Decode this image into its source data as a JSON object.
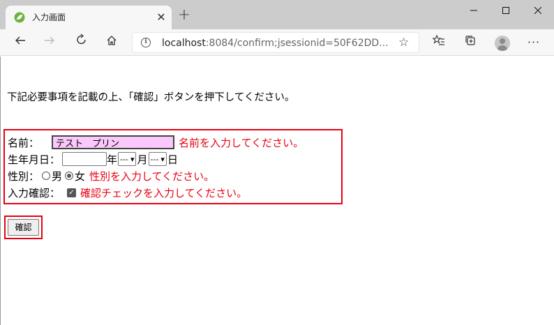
{
  "browser": {
    "tab_title": "入力画面",
    "new_tab_glyph": "+",
    "close_glyph": "✕",
    "url_host": "localhost",
    "url_rest": ":8084/confirm;jsessionid=50F62DD..."
  },
  "page": {
    "instruction": "下記必要事項を記載の上、「確認」ボタンを押下してください。",
    "form": {
      "name_label": "名前：",
      "name_value": "テスト　プリン",
      "name_error": "名前を入力してください。",
      "birth_label": "生年月日：",
      "year_suffix": "年",
      "month_value": "---",
      "month_suffix": "月",
      "day_value": "---",
      "day_suffix": "日",
      "gender_label": "性別：",
      "gender_male": "男",
      "gender_female": "女",
      "gender_selected": "女",
      "gender_error": "性別を入力してください。",
      "confirm_label": "入力確認：",
      "confirm_checked": true,
      "confirm_error": "確認チェックを入力してください。"
    },
    "submit_label": "確認"
  },
  "colors": {
    "error": "#e60012",
    "name_field_bg": "#fbc8fb"
  }
}
